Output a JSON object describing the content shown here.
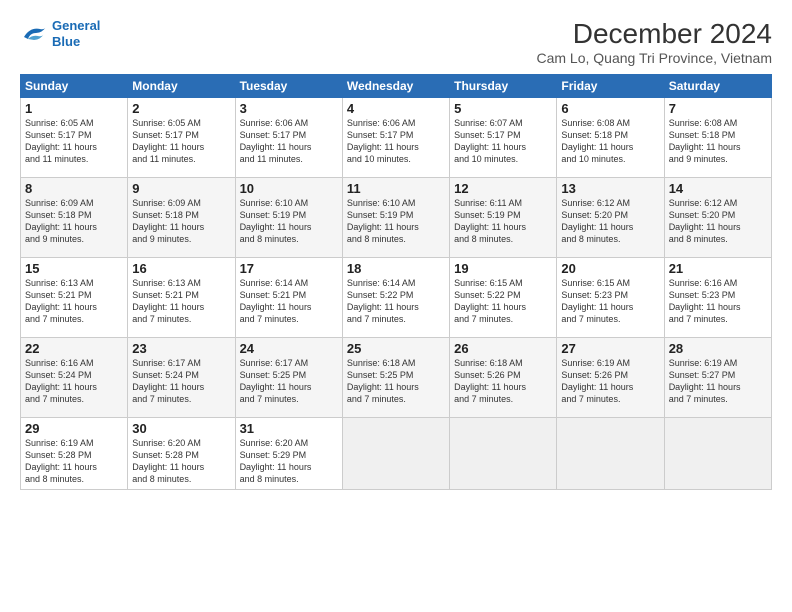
{
  "header": {
    "logo_line1": "General",
    "logo_line2": "Blue",
    "title": "December 2024",
    "subtitle": "Cam Lo, Quang Tri Province, Vietnam"
  },
  "days_of_week": [
    "Sunday",
    "Monday",
    "Tuesday",
    "Wednesday",
    "Thursday",
    "Friday",
    "Saturday"
  ],
  "weeks": [
    [
      {
        "day": "1",
        "info": "Sunrise: 6:05 AM\nSunset: 5:17 PM\nDaylight: 11 hours\nand 11 minutes."
      },
      {
        "day": "2",
        "info": "Sunrise: 6:05 AM\nSunset: 5:17 PM\nDaylight: 11 hours\nand 11 minutes."
      },
      {
        "day": "3",
        "info": "Sunrise: 6:06 AM\nSunset: 5:17 PM\nDaylight: 11 hours\nand 11 minutes."
      },
      {
        "day": "4",
        "info": "Sunrise: 6:06 AM\nSunset: 5:17 PM\nDaylight: 11 hours\nand 10 minutes."
      },
      {
        "day": "5",
        "info": "Sunrise: 6:07 AM\nSunset: 5:17 PM\nDaylight: 11 hours\nand 10 minutes."
      },
      {
        "day": "6",
        "info": "Sunrise: 6:08 AM\nSunset: 5:18 PM\nDaylight: 11 hours\nand 10 minutes."
      },
      {
        "day": "7",
        "info": "Sunrise: 6:08 AM\nSunset: 5:18 PM\nDaylight: 11 hours\nand 9 minutes."
      }
    ],
    [
      {
        "day": "8",
        "info": "Sunrise: 6:09 AM\nSunset: 5:18 PM\nDaylight: 11 hours\nand 9 minutes."
      },
      {
        "day": "9",
        "info": "Sunrise: 6:09 AM\nSunset: 5:18 PM\nDaylight: 11 hours\nand 9 minutes."
      },
      {
        "day": "10",
        "info": "Sunrise: 6:10 AM\nSunset: 5:19 PM\nDaylight: 11 hours\nand 8 minutes."
      },
      {
        "day": "11",
        "info": "Sunrise: 6:10 AM\nSunset: 5:19 PM\nDaylight: 11 hours\nand 8 minutes."
      },
      {
        "day": "12",
        "info": "Sunrise: 6:11 AM\nSunset: 5:19 PM\nDaylight: 11 hours\nand 8 minutes."
      },
      {
        "day": "13",
        "info": "Sunrise: 6:12 AM\nSunset: 5:20 PM\nDaylight: 11 hours\nand 8 minutes."
      },
      {
        "day": "14",
        "info": "Sunrise: 6:12 AM\nSunset: 5:20 PM\nDaylight: 11 hours\nand 8 minutes."
      }
    ],
    [
      {
        "day": "15",
        "info": "Sunrise: 6:13 AM\nSunset: 5:21 PM\nDaylight: 11 hours\nand 7 minutes."
      },
      {
        "day": "16",
        "info": "Sunrise: 6:13 AM\nSunset: 5:21 PM\nDaylight: 11 hours\nand 7 minutes."
      },
      {
        "day": "17",
        "info": "Sunrise: 6:14 AM\nSunset: 5:21 PM\nDaylight: 11 hours\nand 7 minutes."
      },
      {
        "day": "18",
        "info": "Sunrise: 6:14 AM\nSunset: 5:22 PM\nDaylight: 11 hours\nand 7 minutes."
      },
      {
        "day": "19",
        "info": "Sunrise: 6:15 AM\nSunset: 5:22 PM\nDaylight: 11 hours\nand 7 minutes."
      },
      {
        "day": "20",
        "info": "Sunrise: 6:15 AM\nSunset: 5:23 PM\nDaylight: 11 hours\nand 7 minutes."
      },
      {
        "day": "21",
        "info": "Sunrise: 6:16 AM\nSunset: 5:23 PM\nDaylight: 11 hours\nand 7 minutes."
      }
    ],
    [
      {
        "day": "22",
        "info": "Sunrise: 6:16 AM\nSunset: 5:24 PM\nDaylight: 11 hours\nand 7 minutes."
      },
      {
        "day": "23",
        "info": "Sunrise: 6:17 AM\nSunset: 5:24 PM\nDaylight: 11 hours\nand 7 minutes."
      },
      {
        "day": "24",
        "info": "Sunrise: 6:17 AM\nSunset: 5:25 PM\nDaylight: 11 hours\nand 7 minutes."
      },
      {
        "day": "25",
        "info": "Sunrise: 6:18 AM\nSunset: 5:25 PM\nDaylight: 11 hours\nand 7 minutes."
      },
      {
        "day": "26",
        "info": "Sunrise: 6:18 AM\nSunset: 5:26 PM\nDaylight: 11 hours\nand 7 minutes."
      },
      {
        "day": "27",
        "info": "Sunrise: 6:19 AM\nSunset: 5:26 PM\nDaylight: 11 hours\nand 7 minutes."
      },
      {
        "day": "28",
        "info": "Sunrise: 6:19 AM\nSunset: 5:27 PM\nDaylight: 11 hours\nand 7 minutes."
      }
    ],
    [
      {
        "day": "29",
        "info": "Sunrise: 6:19 AM\nSunset: 5:28 PM\nDaylight: 11 hours\nand 8 minutes."
      },
      {
        "day": "30",
        "info": "Sunrise: 6:20 AM\nSunset: 5:28 PM\nDaylight: 11 hours\nand 8 minutes."
      },
      {
        "day": "31",
        "info": "Sunrise: 6:20 AM\nSunset: 5:29 PM\nDaylight: 11 hours\nand 8 minutes."
      },
      {
        "day": "",
        "info": ""
      },
      {
        "day": "",
        "info": ""
      },
      {
        "day": "",
        "info": ""
      },
      {
        "day": "",
        "info": ""
      }
    ]
  ]
}
